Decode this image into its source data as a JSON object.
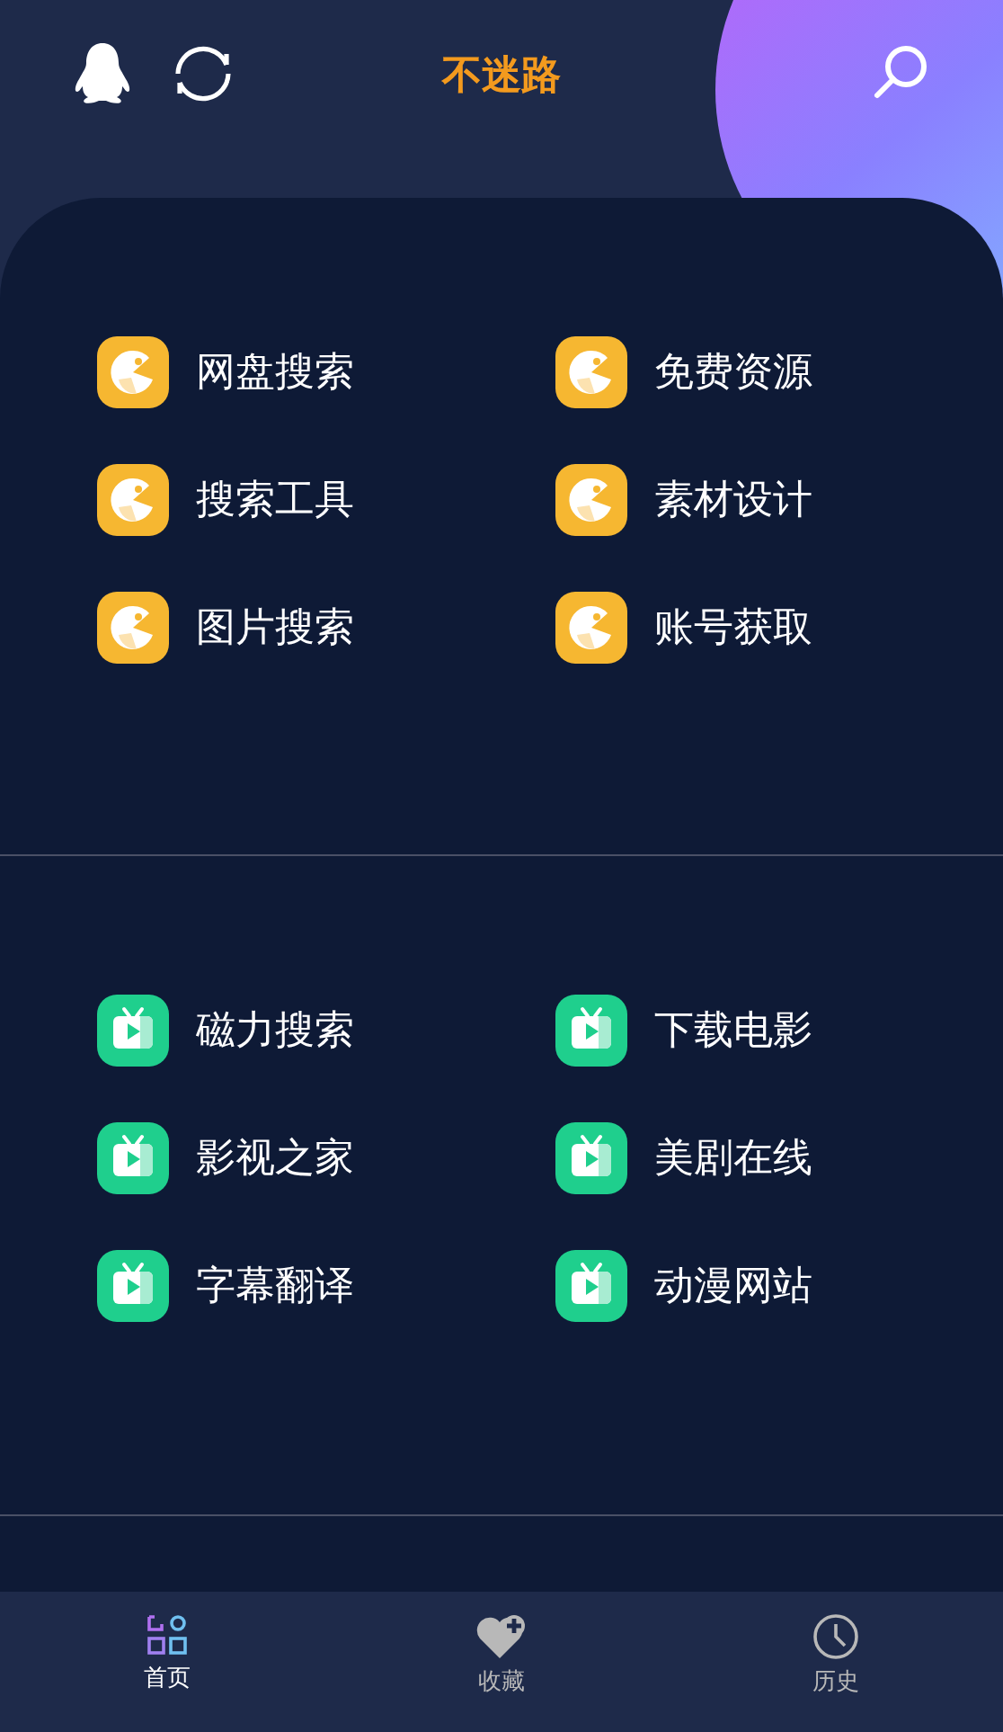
{
  "header": {
    "title": "不迷路"
  },
  "sections": [
    {
      "kind": "game",
      "items": [
        {
          "label": "网盘搜索"
        },
        {
          "label": "免费资源"
        },
        {
          "label": "搜索工具"
        },
        {
          "label": "素材设计"
        },
        {
          "label": "图片搜索"
        },
        {
          "label": "账号获取"
        }
      ]
    },
    {
      "kind": "video",
      "items": [
        {
          "label": "磁力搜索"
        },
        {
          "label": "下载电影"
        },
        {
          "label": "影视之家"
        },
        {
          "label": "美剧在线"
        },
        {
          "label": "字幕翻译"
        },
        {
          "label": "动漫网站"
        }
      ]
    }
  ],
  "tabs": [
    {
      "label": "首页",
      "kind": "home",
      "selected": true
    },
    {
      "label": "收藏",
      "kind": "fav",
      "selected": false
    },
    {
      "label": "历史",
      "kind": "history",
      "selected": false
    }
  ]
}
